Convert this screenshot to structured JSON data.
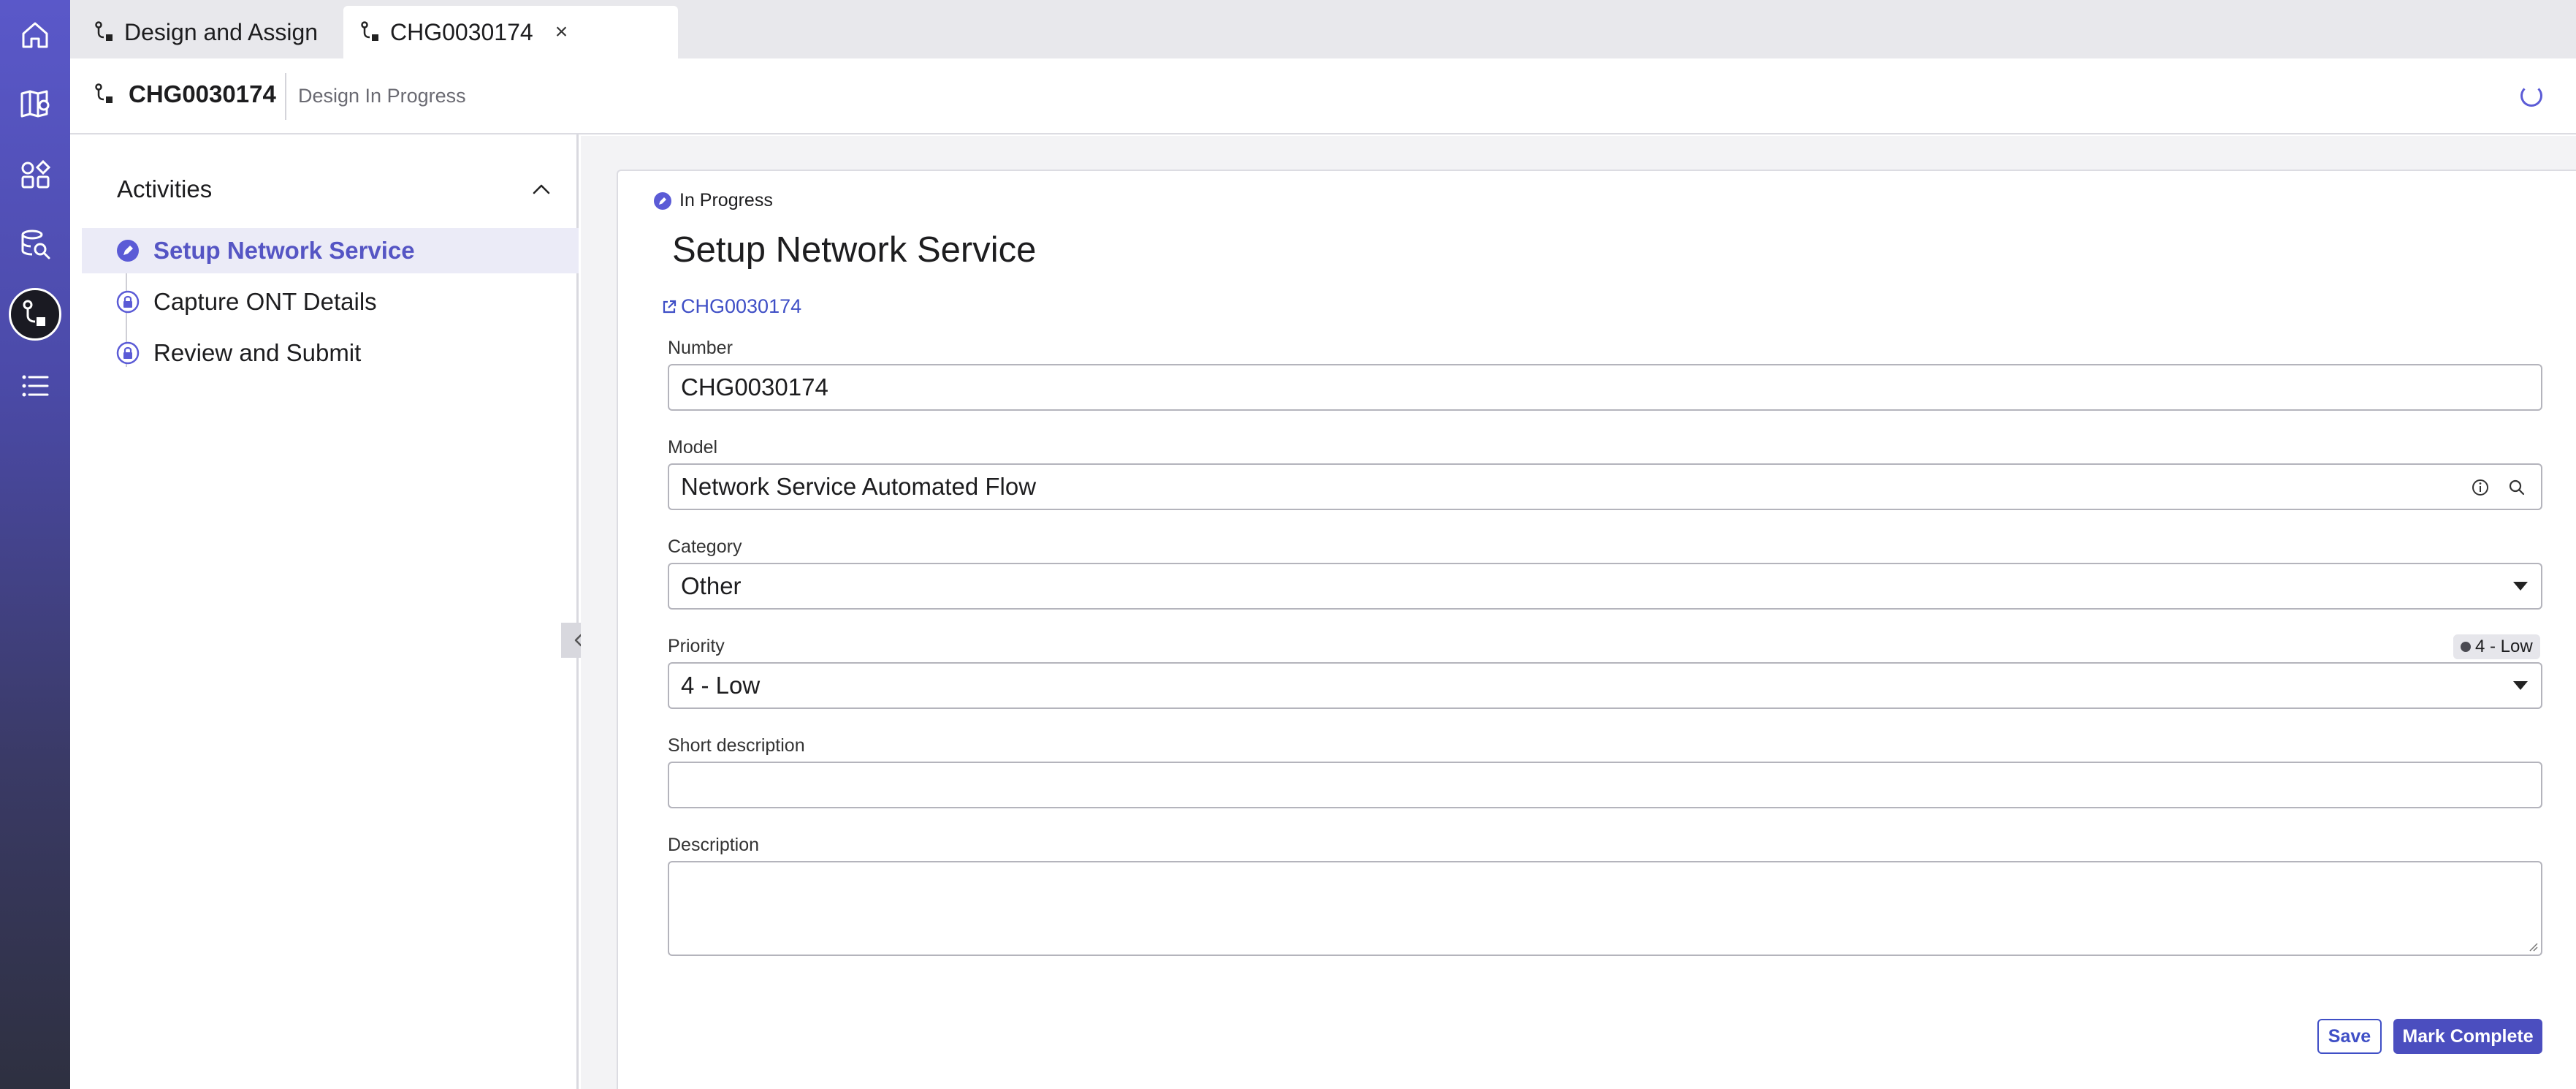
{
  "tabs": [
    {
      "label": "Design and Assign",
      "icon": "workflow-icon"
    },
    {
      "label": "CHG0030174",
      "icon": "workflow-icon",
      "close": "×"
    }
  ],
  "record": {
    "number": "CHG0030174",
    "state": "Design In Progress"
  },
  "activities": {
    "title": "Activities",
    "items": [
      {
        "label": "Setup Network Service",
        "status": "in-progress"
      },
      {
        "label": "Capture ONT Details",
        "status": "locked"
      },
      {
        "label": "Review and Submit",
        "status": "locked"
      }
    ]
  },
  "form": {
    "state_label": "In Progress",
    "title": "Setup Network Service",
    "record_link": "CHG0030174",
    "fields": {
      "number": {
        "label": "Number",
        "value": "CHG0030174"
      },
      "model": {
        "label": "Model",
        "value": "Network Service Automated Flow"
      },
      "category": {
        "label": "Category",
        "value": "Other"
      },
      "priority": {
        "label": "Priority",
        "value": "4 - Low",
        "badge": "4 - Low"
      },
      "short_description": {
        "label": "Short description",
        "value": ""
      },
      "description": {
        "label": "Description",
        "value": ""
      }
    },
    "buttons": {
      "save": "Save",
      "complete": "Mark Complete"
    }
  },
  "colors": {
    "accent": "#5b5bd6",
    "rail_top": "#5a58c9",
    "rail_bottom": "#2e3040",
    "link": "#3f4fc6",
    "primary_button": "#4b4ebf"
  }
}
